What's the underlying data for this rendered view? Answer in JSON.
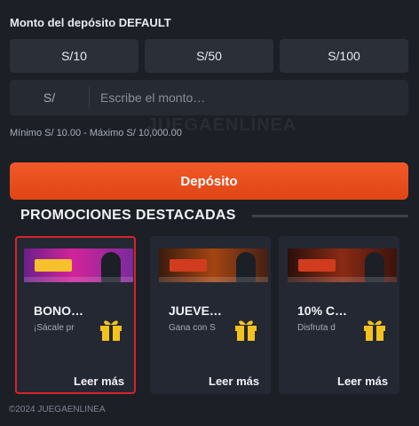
{
  "deposit": {
    "title": "Monto del depósito DEFAULT",
    "quick_amounts": [
      "S/10",
      "S/50",
      "S/100"
    ],
    "currency": "S/",
    "input_placeholder": "Escribe el monto…",
    "input_value": "",
    "limits": "Mínimo S/ 10.00 - Máximo S/ 10,000.00",
    "button_label": "Depósito"
  },
  "watermark": "JUEGAENLÍNEA",
  "promotions": {
    "heading": "PROMOCIONES DESTACADAS",
    "cards": [
      {
        "title": "BONO…",
        "desc": "¡Sácale pr",
        "more": "Leer más",
        "selected": true
      },
      {
        "title": "JUEVE…",
        "desc": "Gana con S",
        "more": "Leer más",
        "selected": false
      },
      {
        "title": "10% C…",
        "desc": "Disfruta d",
        "more": "Leer más",
        "selected": false
      }
    ]
  },
  "footer": {
    "copyright": "©2024 JUEGAENLINEA"
  },
  "colors": {
    "accent": "#e84c1c",
    "selection": "#d8232a",
    "gift": "#f4c21f"
  }
}
